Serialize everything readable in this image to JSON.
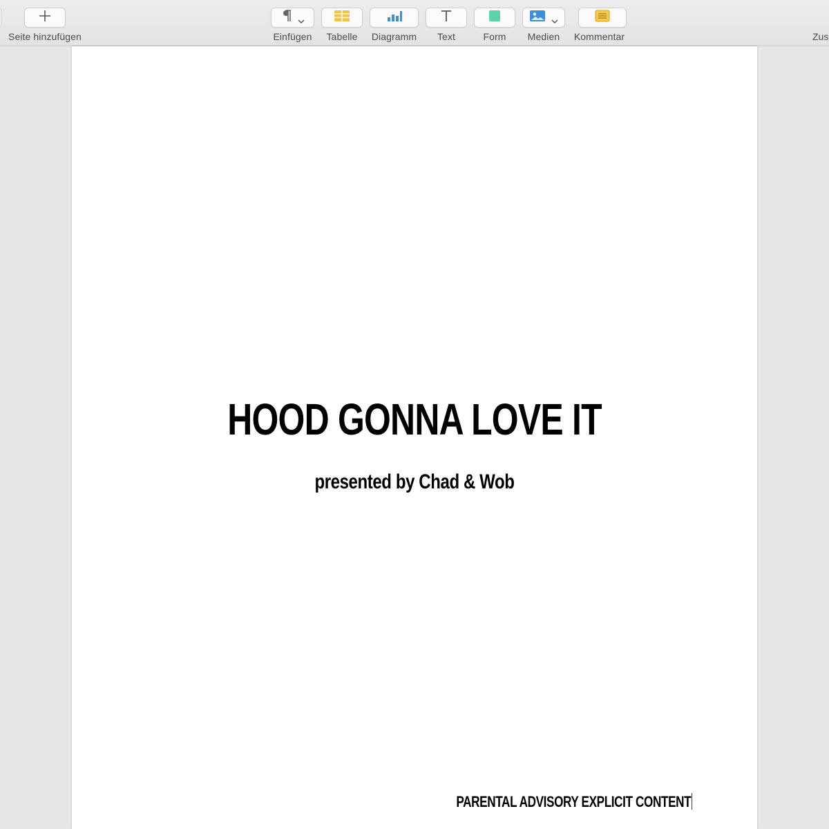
{
  "toolbar": {
    "add_page": {
      "label": "Seite hinzufügen",
      "icon": "plus-icon"
    },
    "insert": {
      "label": "Einfügen",
      "icon": "pilcrow-icon"
    },
    "table": {
      "label": "Tabelle",
      "icon": "table-icon",
      "color": "#f5c242"
    },
    "chart": {
      "label": "Diagramm",
      "icon": "bar-chart-icon",
      "color": "#3c8ee0"
    },
    "text": {
      "label": "Text",
      "icon": "text-icon"
    },
    "shape": {
      "label": "Form",
      "icon": "shape-icon",
      "color": "#5fd3a8"
    },
    "media": {
      "label": "Medien",
      "icon": "image-icon",
      "color": "#3c8ee0"
    },
    "comment": {
      "label": "Kommentar",
      "icon": "comment-icon",
      "color": "#f7c948"
    },
    "right_cut_label": "Zusammenarbeit"
  },
  "document": {
    "title": "HOOD GONNA LOVE IT",
    "subtitle": "presented by Chad & Wob",
    "footer": "PARENTAL ADVISORY EXPLICIT CONTENT"
  }
}
